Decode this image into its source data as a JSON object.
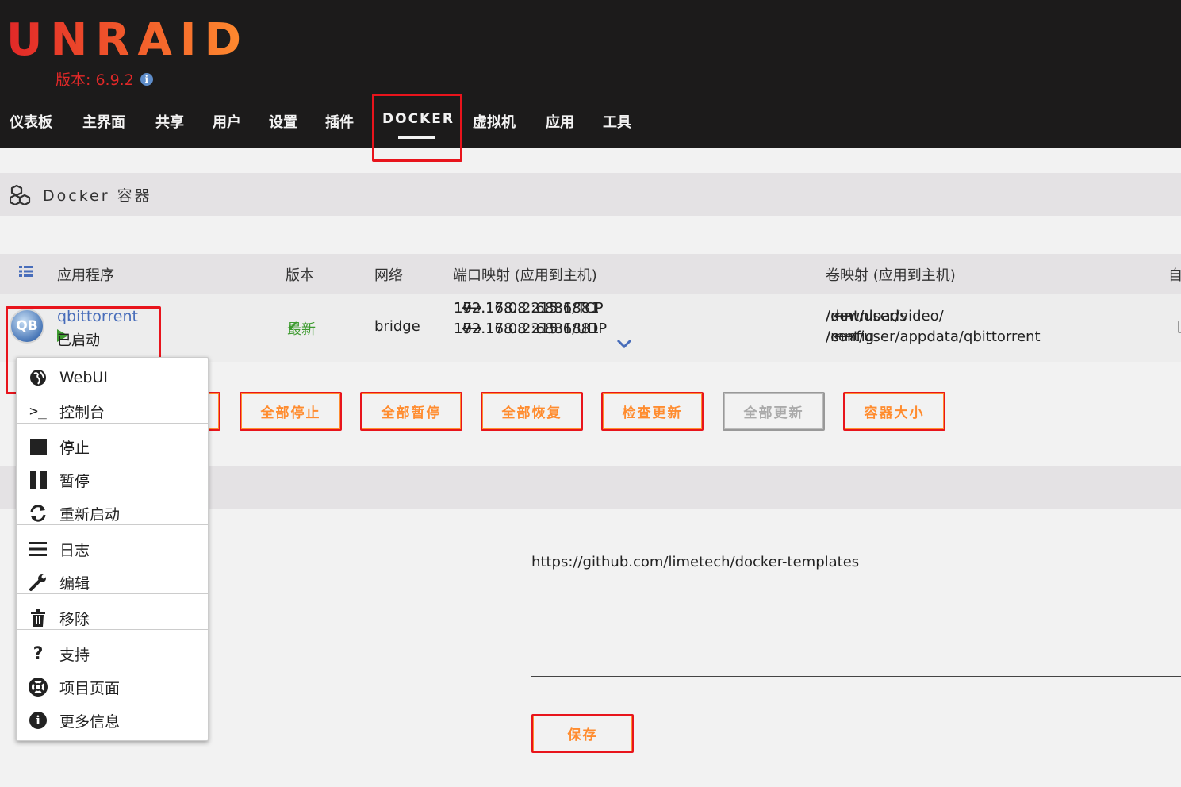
{
  "header": {
    "logo": "UNRAID",
    "version": "版本: 6.9.2",
    "nav": [
      "仪表板",
      "主界面",
      "共享",
      "用户",
      "设置",
      "插件",
      "DOCKER",
      "虚拟机",
      "应用",
      "工具"
    ],
    "active_nav": "DOCKER"
  },
  "section": {
    "title": "Docker 容器"
  },
  "table": {
    "columns": [
      "应用程序",
      "版本",
      "网络",
      "端口映射 (应用到主机)",
      "卷映射 (应用到主机)",
      "自"
    ],
    "row": {
      "icon_text": "QB",
      "name": "qbittorrent",
      "status": "已启动",
      "version": "最新",
      "network": "bridge",
      "ports": [
        {
          "app": "172.17.0.2:6881/TCP",
          "host": "192.168.8.215:6881"
        },
        {
          "app": "172.17.0.2:6881/UDP",
          "host": "192.168.8.215:6881"
        }
      ],
      "volumes": [
        {
          "app": "/downloads",
          "host": "/mnt/user/video/"
        },
        {
          "app": "/config",
          "host": "/mnt/user/appdata/qbittorrent"
        }
      ]
    }
  },
  "buttons": [
    "全部停止",
    "全部暂停",
    "全部恢复",
    "检查更新",
    "全部更新",
    "容器大小"
  ],
  "template_url": "https://github.com/limetech/docker-templates",
  "save_label": "保存",
  "menu": {
    "items": [
      "WebUI",
      "控制台",
      "停止",
      "暂停",
      "重新启动",
      "日志",
      "编辑",
      "移除",
      "支持",
      "项目页面",
      "更多信息"
    ],
    "icons": [
      "globe-icon",
      "terminal-icon",
      "stop-icon",
      "pause-icon",
      "refresh-icon",
      "list-icon",
      "wrench-icon",
      "trash-icon",
      "question-icon",
      "lifebuoy-icon",
      "info-icon"
    ]
  },
  "colors": {
    "header_bg": "#1c1b1b",
    "accent_orange": "#ff8c2f",
    "accent_red": "#e8141c",
    "link_blue": "#486dba",
    "ok_green": "#3e9b30"
  }
}
